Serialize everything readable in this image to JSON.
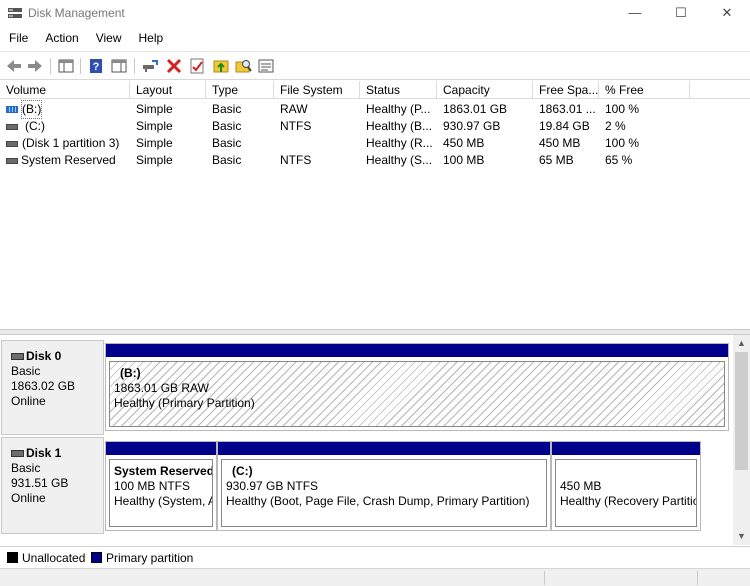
{
  "window": {
    "title": "Disk Management",
    "minimize": "—",
    "maximize": "☐",
    "close": "✕"
  },
  "menu": [
    "File",
    "Action",
    "View",
    "Help"
  ],
  "toolbar": {
    "icons": [
      "back-icon",
      "forward-icon",
      "console-tree-icon",
      "help-icon",
      "show-pane-icon",
      "connect-disk-icon",
      "delete-icon",
      "properties-icon",
      "up-icon",
      "explore-icon",
      "view-list-icon"
    ]
  },
  "columns": [
    "Volume",
    "Layout",
    "Type",
    "File System",
    "Status",
    "Capacity",
    "Free Spa...",
    "% Free"
  ],
  "volumes": [
    {
      "name": "(B:)",
      "layout": "Simple",
      "type": "Basic",
      "fs": "RAW",
      "status": "Healthy (P...",
      "capacity": "1863.01 GB",
      "free": "1863.01 ...",
      "pct": "100 %"
    },
    {
      "name": "(C:)",
      "layout": "Simple",
      "type": "Basic",
      "fs": "NTFS",
      "status": "Healthy (B...",
      "capacity": "930.97 GB",
      "free": "19.84 GB",
      "pct": "2 %"
    },
    {
      "name": "(Disk 1 partition 3)",
      "layout": "Simple",
      "type": "Basic",
      "fs": "",
      "status": "Healthy (R...",
      "capacity": "450 MB",
      "free": "450 MB",
      "pct": "100 %"
    },
    {
      "name": "System Reserved",
      "layout": "Simple",
      "type": "Basic",
      "fs": "NTFS",
      "status": "Healthy (S...",
      "capacity": "100 MB",
      "free": "65 MB",
      "pct": "65 %"
    }
  ],
  "disks": [
    {
      "name": "Disk 0",
      "type": "Basic",
      "size": "1863.02 GB",
      "state": "Online",
      "partitions": [
        {
          "name": "(B:)",
          "size_fs": "1863.01 GB RAW",
          "status": "Healthy (Primary Partition)"
        }
      ]
    },
    {
      "name": "Disk 1",
      "type": "Basic",
      "size": "931.51 GB",
      "state": "Online",
      "partitions": [
        {
          "name": "System Reserved",
          "size_fs": "100 MB NTFS",
          "status": "Healthy (System, A"
        },
        {
          "name": "(C:)",
          "size_fs": "930.97 GB NTFS",
          "status": "Healthy (Boot, Page File, Crash Dump, Primary Partition)"
        },
        {
          "name": "",
          "size_fs": "450 MB",
          "status": "Healthy (Recovery Partitio"
        }
      ]
    }
  ],
  "legend": [
    {
      "label": "Unallocated",
      "color": "#000000"
    },
    {
      "label": "Primary partition",
      "color": "#00008a"
    }
  ],
  "scrollbar": {
    "up": "▲",
    "down": "▼"
  }
}
